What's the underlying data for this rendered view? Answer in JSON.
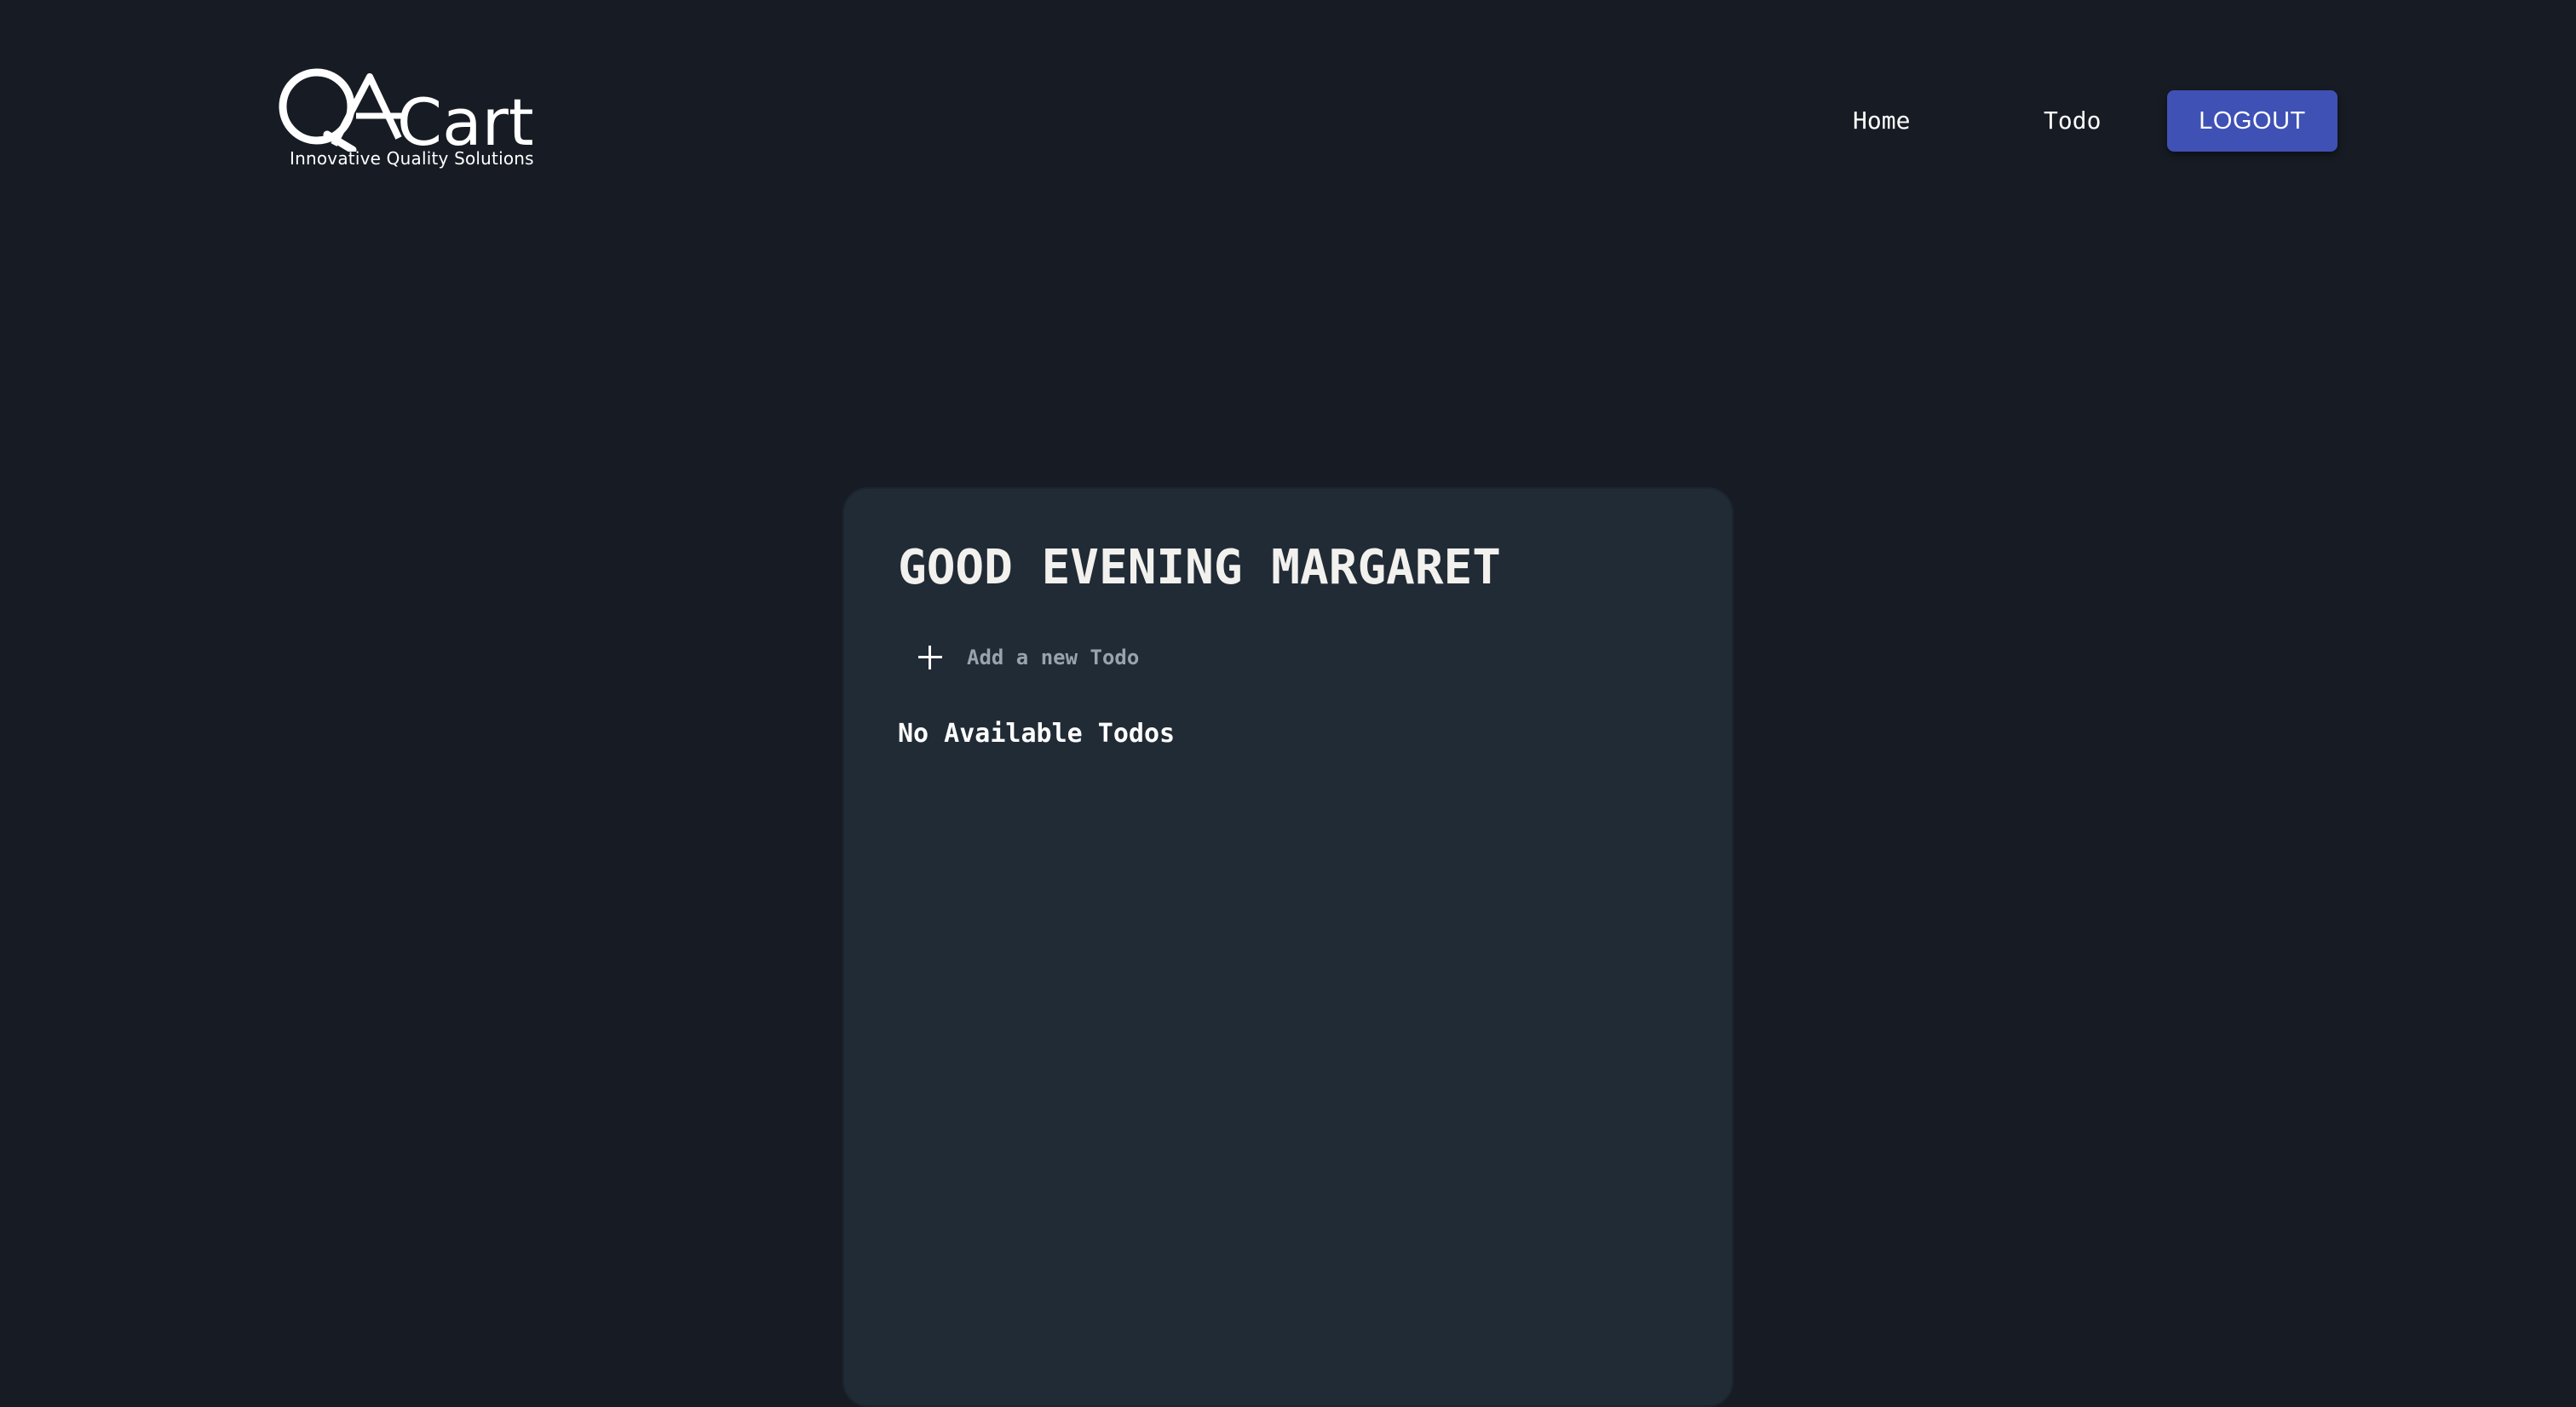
{
  "header": {
    "logo": {
      "brand_mark": "QA",
      "brand_name": "Cart",
      "tagline": "Innovative Quality Solutions"
    },
    "nav": {
      "home_label": "Home",
      "todo_label": "Todo"
    },
    "logout_label": "LOGOUT"
  },
  "main": {
    "greeting": "GOOD EVENING MARGARET",
    "add_todo": {
      "placeholder": "Add a new Todo",
      "value": "",
      "icon": "plus-icon"
    },
    "empty_message": "No Available Todos"
  },
  "colors": {
    "page_background": "#171c24",
    "card_background": "#212b36",
    "accent": "#3f51b5",
    "greeting_text": "#f2f1ee",
    "placeholder_text": "#9aa3ad"
  }
}
